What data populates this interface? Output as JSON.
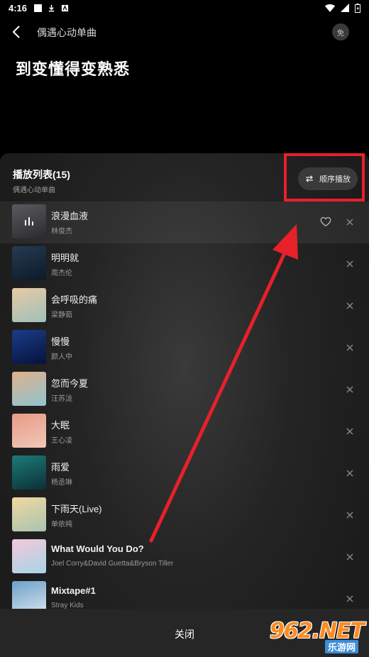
{
  "status": {
    "time": "4:16"
  },
  "header": {
    "title": "偶遇心动单曲",
    "avatar_text": "免",
    "headline": "到变懂得变熟悉"
  },
  "playlist": {
    "title": "播放列表(15)",
    "subtitle": "偶遇心动单曲",
    "mode_label": "顺序播放",
    "current_index": 0,
    "items": [
      {
        "song": "浪漫血液",
        "artist": "林俊杰",
        "cover_colors": [
          "#5a5a60",
          "#2a2a2e"
        ]
      },
      {
        "song": "明明就",
        "artist": "周杰伦",
        "cover_colors": [
          "#263a52",
          "#0c1a28"
        ]
      },
      {
        "song": "会呼吸的痛",
        "artist": "梁静茹",
        "cover_colors": [
          "#e8c9a6",
          "#9fc0b8"
        ]
      },
      {
        "song": "慢慢",
        "artist": "颜人中",
        "cover_colors": [
          "#1b3c8a",
          "#06123a"
        ]
      },
      {
        "song": "忽而今夏",
        "artist": "汪苏泷",
        "cover_colors": [
          "#e0b08c",
          "#8fc4d0"
        ]
      },
      {
        "song": "大眠",
        "artist": "王心凌",
        "cover_colors": [
          "#e89a86",
          "#f0c8b8"
        ]
      },
      {
        "song": "雨爱",
        "artist": "杨丞琳",
        "cover_colors": [
          "#1e7a7a",
          "#0a3036"
        ]
      },
      {
        "song": "下雨天(Live)",
        "artist": "单依纯",
        "cover_colors": [
          "#f0d8a0",
          "#a8c4b0"
        ]
      },
      {
        "song": "What Would You Do?",
        "artist": "Joel Corry&David Guetta&Bryson Tiller",
        "cover_colors": [
          "#f3c8d8",
          "#a8d4e8"
        ]
      },
      {
        "song": "Mixtape#1",
        "artist": "Stray Kids",
        "cover_colors": [
          "#6ea0c8",
          "#d8e4f0"
        ]
      }
    ]
  },
  "footer": {
    "close_label": "关闭"
  },
  "watermark": {
    "logo": "962.NET",
    "sub": "乐游网"
  },
  "colors": {
    "annotation": "#e8202a"
  }
}
